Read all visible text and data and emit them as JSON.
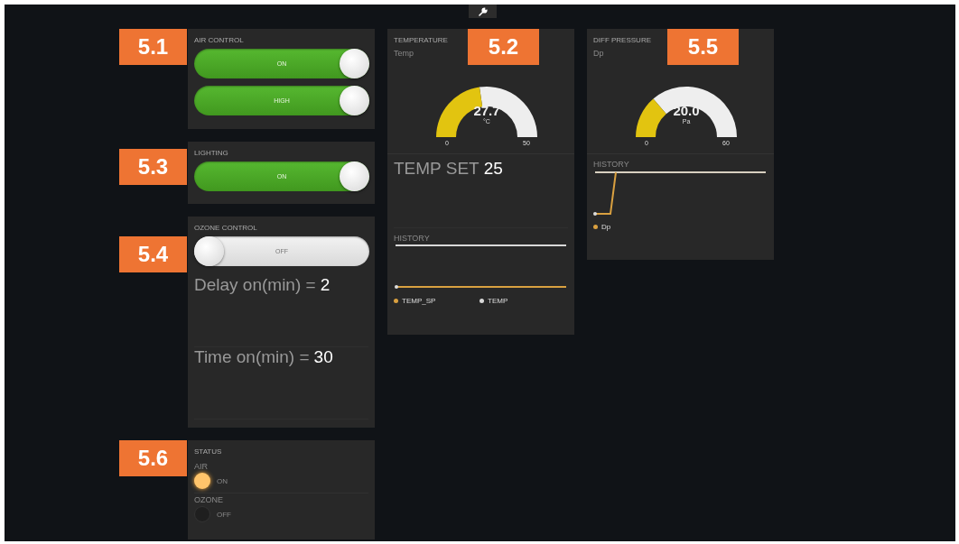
{
  "callouts": [
    {
      "label": "5.1"
    },
    {
      "label": "5.2"
    },
    {
      "label": "5.3"
    },
    {
      "label": "5.4"
    },
    {
      "label": "5.5"
    },
    {
      "label": "5.6"
    }
  ],
  "air_control": {
    "title": "AIR CONTROL",
    "switches": [
      {
        "label": "ON",
        "on": true
      },
      {
        "label": "HIGH",
        "on": true
      }
    ]
  },
  "lighting": {
    "title": "LIGHTING",
    "switches": [
      {
        "label": "ON",
        "on": true
      }
    ]
  },
  "ozone_control": {
    "title": "OZONE CONTROL",
    "switches": [
      {
        "label": "OFF",
        "on": false
      }
    ],
    "values": [
      {
        "label": "Delay on(min) =",
        "value": "2"
      },
      {
        "label": "Time on(min) =",
        "value": "30"
      }
    ]
  },
  "status": {
    "title": "STATUS",
    "indicators": [
      {
        "label": "AIR",
        "state": "ON",
        "on": true
      },
      {
        "label": "OZONE",
        "state": "OFF",
        "on": false
      }
    ]
  },
  "temperature": {
    "title": "TEMPERATURE",
    "gauge": {
      "label": "Temp",
      "value": "27.7",
      "unit": "°C",
      "min": "0",
      "max": "50"
    },
    "values": [
      {
        "label": "TEMP SET",
        "value": "25"
      }
    ],
    "history": {
      "title": "HISTORY",
      "legend": [
        {
          "name": "TEMP_SP",
          "color": "#d9a040"
        },
        {
          "name": "TEMP",
          "color": "#d8d8d8"
        }
      ]
    }
  },
  "diff_pressure": {
    "title": "DIFF PRESSURE",
    "gauge": {
      "label": "Dp",
      "value": "20.0",
      "unit": "Pa",
      "min": "0",
      "max": "60"
    },
    "history": {
      "title": "HISTORY",
      "legend": [
        {
          "name": "Dp",
          "color": "#d9a040"
        }
      ]
    }
  }
}
